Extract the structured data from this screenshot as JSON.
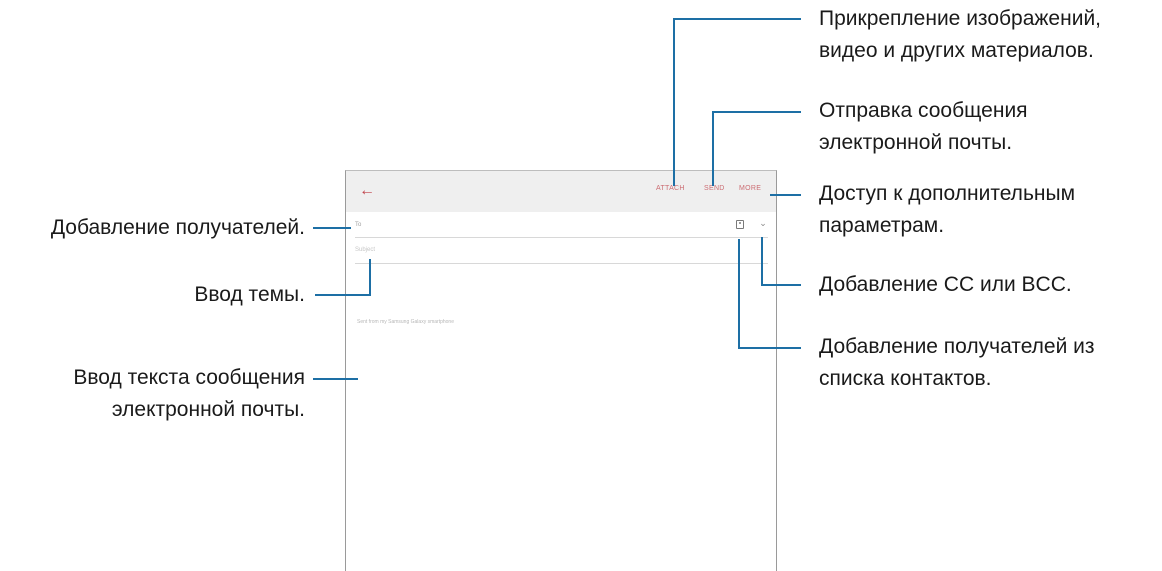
{
  "screen": {
    "back_icon": "arrow-left-icon",
    "actions": {
      "attach": "ATTACH",
      "send": "SEND",
      "more": "MORE"
    },
    "to_label": "To",
    "subject_placeholder": "Subject",
    "body_text": "Sent from my Samsung Galaxy smartphone",
    "contact_icon": "contact-card-icon",
    "expand_icon": "chevron-down-icon",
    "accent_color": "#c0424a"
  },
  "annotations": {
    "attach": [
      "Прикрепление изображений,",
      "видео и других материалов."
    ],
    "send": [
      "Отправка сообщения",
      "электронной почты."
    ],
    "more": [
      "Доступ к дополнительным",
      "параметрам."
    ],
    "cc_bcc": "Добавление CC или BCC.",
    "contacts": [
      "Добавление получателей из",
      "списка контактов."
    ],
    "recipients": "Добавление получателей.",
    "subject": "Ввод темы.",
    "body": [
      "Ввод текста сообщения",
      "электронной почты."
    ]
  },
  "line_color": "#1d6fa5"
}
